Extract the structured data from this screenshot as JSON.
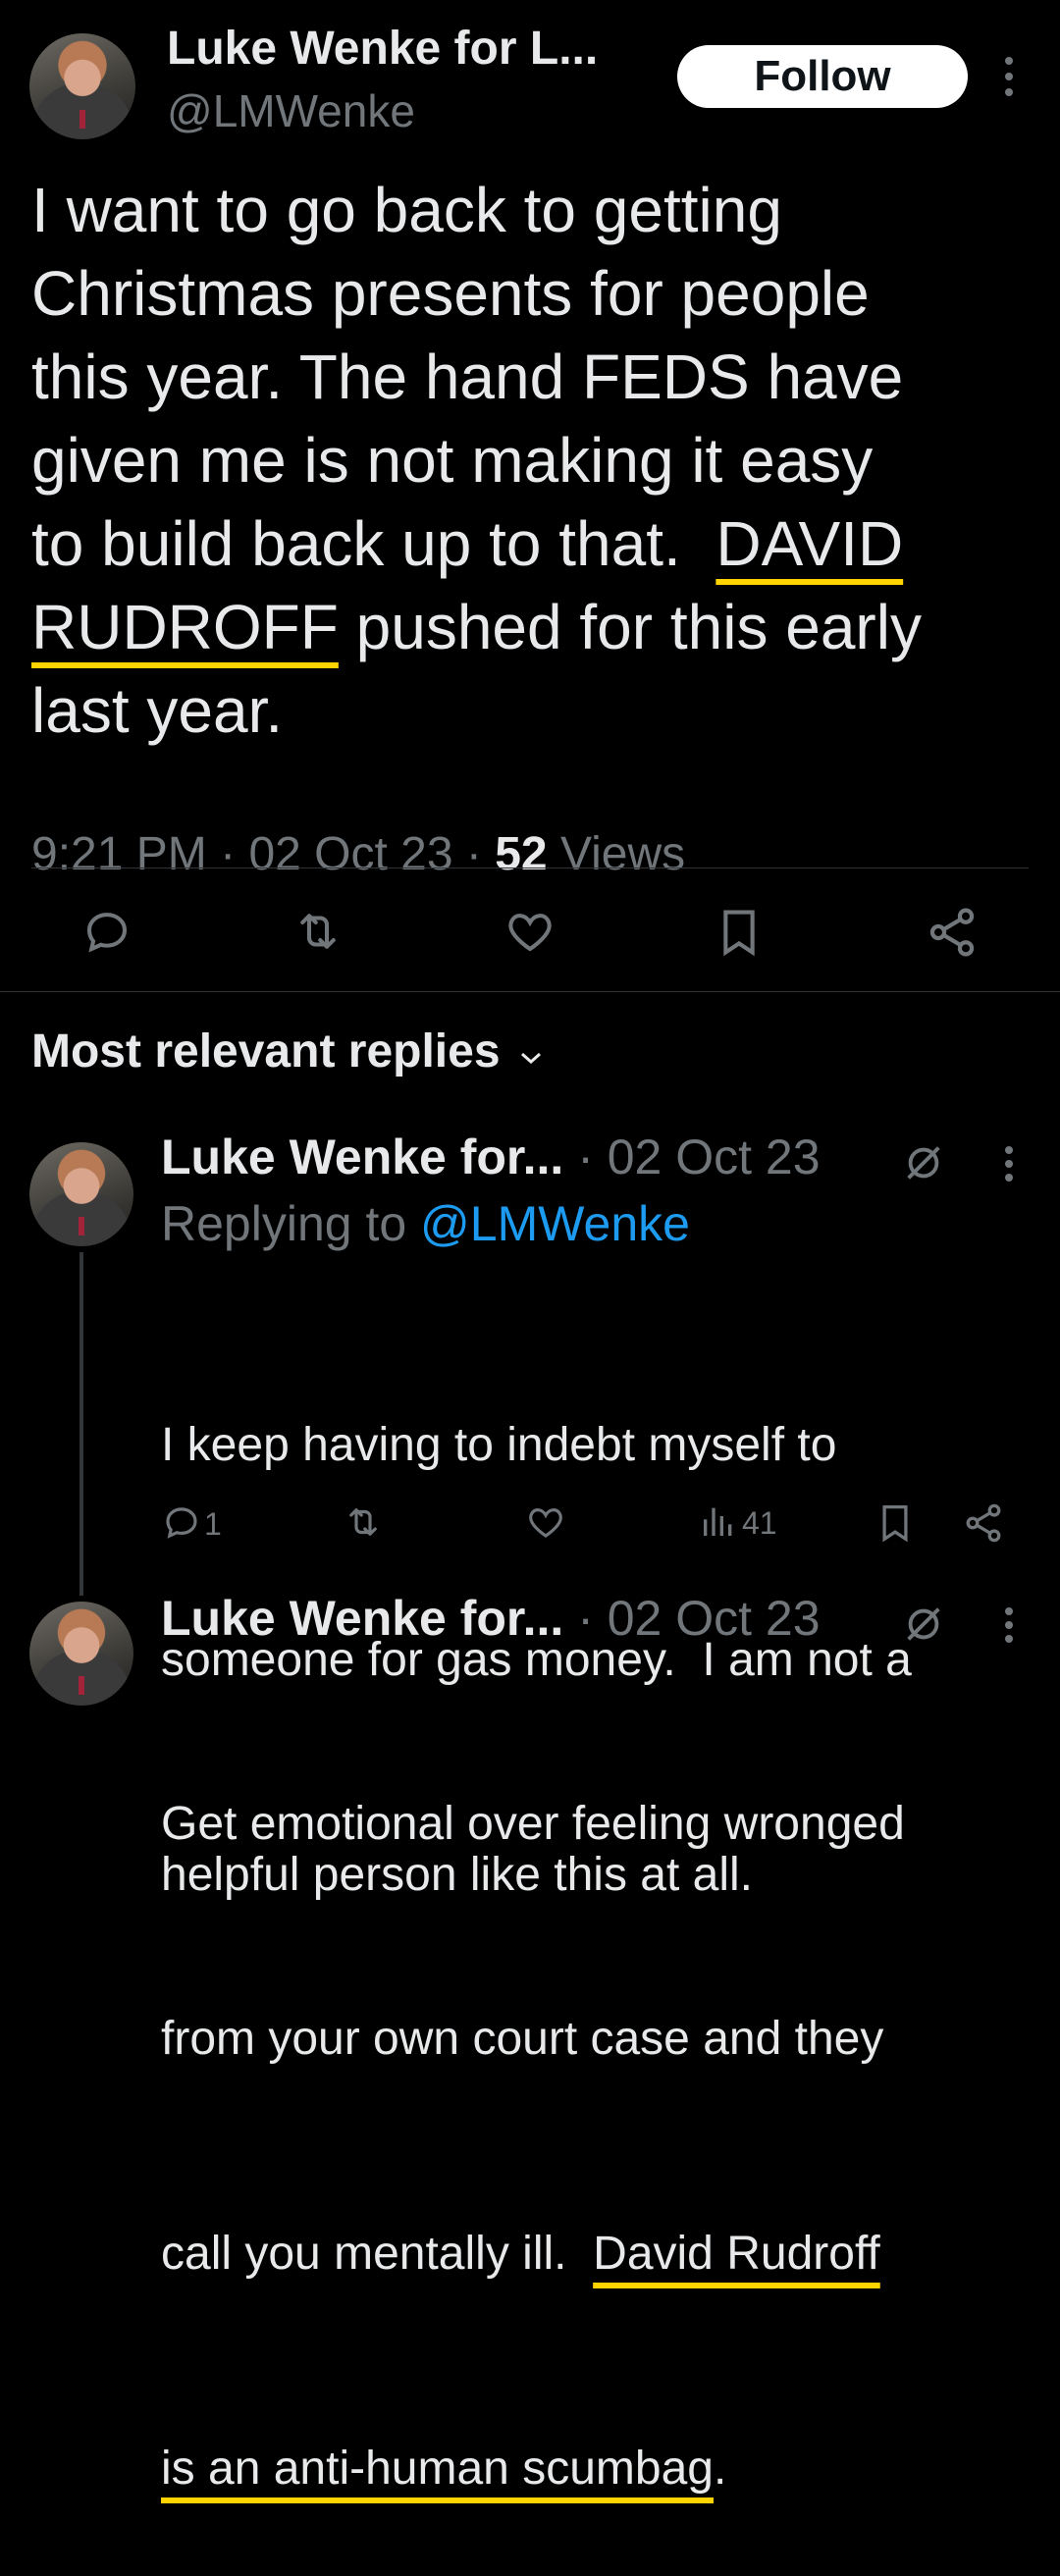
{
  "tweet": {
    "author_name": "Luke Wenke for L...",
    "author_handle": "@LMWenke",
    "follow_label": "Follow",
    "text_lines": [
      "I want to go back to getting",
      "Christmas presents for people",
      "this year.  The hand FEDS have",
      "given me is not making it easy",
      "to build back up to that.  "
    ],
    "underlined_1": "DAVID",
    "underlined_2": "RUDROFF",
    "text_after": " pushed for this early",
    "text_last": "last year.",
    "time": "9:21 PM",
    "date": "02 Oct 23",
    "views_count": "52",
    "views_label": "Views",
    "sep": "·"
  },
  "actions": {
    "icons": [
      "reply-icon",
      "retweet-icon",
      "like-icon",
      "bookmark-icon",
      "share-icon"
    ]
  },
  "replies_header": "Most relevant replies",
  "replies": [
    {
      "author_name": "Luke Wenke for...",
      "date": "02 Oct 23",
      "replying_prefix": "Replying to ",
      "replying_handle": "@LMWenke",
      "lines": [
        "I keep having to indebt myself to",
        "someone for gas money.  I am not a",
        "helpful person like this at all."
      ],
      "reply_count": "1",
      "views_count": "41"
    },
    {
      "author_name": "Luke Wenke for...",
      "date": "02 Oct 23",
      "line1": "Get emotional over feeling wronged",
      "line2": "from your own court case and they",
      "line3_plain": "call you mentally ill.  ",
      "line3_ul": "David Rudroff",
      "line4_ul": "is an anti-human scumbag",
      "line4_end": "."
    }
  ],
  "colors": {
    "background": "#000000",
    "text": "#e7e9ea",
    "muted": "#71767b",
    "link": "#1d9bf0",
    "highlight": "#ffd400"
  }
}
